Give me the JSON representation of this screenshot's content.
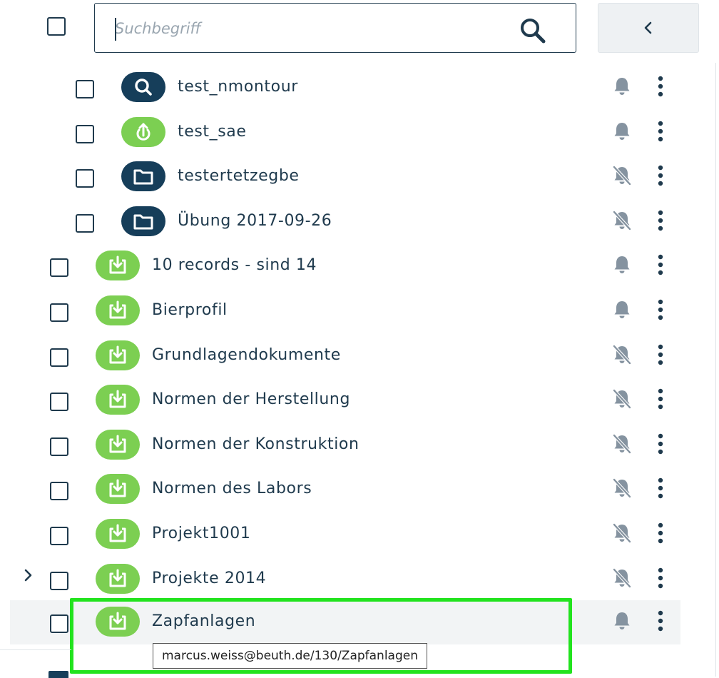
{
  "search": {
    "placeholder": "Suchbegriff",
    "value": ""
  },
  "header": {
    "collapse_icon": "chevron-left-icon"
  },
  "rows": [
    {
      "label": "test_nmontour",
      "icon": "search-icon",
      "pill_color": "#163e5a",
      "notifications": "on",
      "level": 1
    },
    {
      "label": "test_sae",
      "icon": "upload-hand-icon",
      "pill_color": "#7ccf52",
      "notifications": "on",
      "level": 1
    },
    {
      "label": "testertetzegbe",
      "icon": "folder-icon",
      "pill_color": "#163e5a",
      "notifications": "off",
      "level": 1
    },
    {
      "label": "Übung 2017-09-26",
      "icon": "folder-icon",
      "pill_color": "#163e5a",
      "notifications": "off",
      "level": 1
    },
    {
      "label": "10 records - sind 14",
      "icon": "inbox-download-icon",
      "pill_color": "#7ccf52",
      "notifications": "on",
      "level": 0
    },
    {
      "label": "Bierprofil",
      "icon": "inbox-download-icon",
      "pill_color": "#7ccf52",
      "notifications": "on",
      "level": 0
    },
    {
      "label": "Grundlagendokumente",
      "icon": "inbox-download-icon",
      "pill_color": "#7ccf52",
      "notifications": "off",
      "level": 0
    },
    {
      "label": "Normen der Herstellung",
      "icon": "inbox-download-icon",
      "pill_color": "#7ccf52",
      "notifications": "off",
      "level": 0
    },
    {
      "label": "Normen der Konstruktion",
      "icon": "inbox-download-icon",
      "pill_color": "#7ccf52",
      "notifications": "off",
      "level": 0
    },
    {
      "label": "Normen des Labors",
      "icon": "inbox-download-icon",
      "pill_color": "#7ccf52",
      "notifications": "off",
      "level": 0
    },
    {
      "label": "Projekt1001",
      "icon": "inbox-download-icon",
      "pill_color": "#7ccf52",
      "notifications": "off",
      "level": 0
    },
    {
      "label": "Projekte 2014",
      "icon": "inbox-download-icon",
      "pill_color": "#7ccf52",
      "notifications": "off",
      "level": 0,
      "expandable": true
    },
    {
      "label": "Zapfanlagen",
      "icon": "inbox-download-icon",
      "pill_color": "#7ccf52",
      "notifications": "on",
      "level": 0,
      "hovered": true
    }
  ],
  "tooltip": {
    "text": "marcus.weiss@beuth.de/130/Zapfanlagen"
  },
  "colors": {
    "navy": "#163e5a",
    "green": "#7ccf52",
    "text": "#1f3a4d",
    "icon_gray": "#8593a0",
    "focus": "#22e31e"
  }
}
